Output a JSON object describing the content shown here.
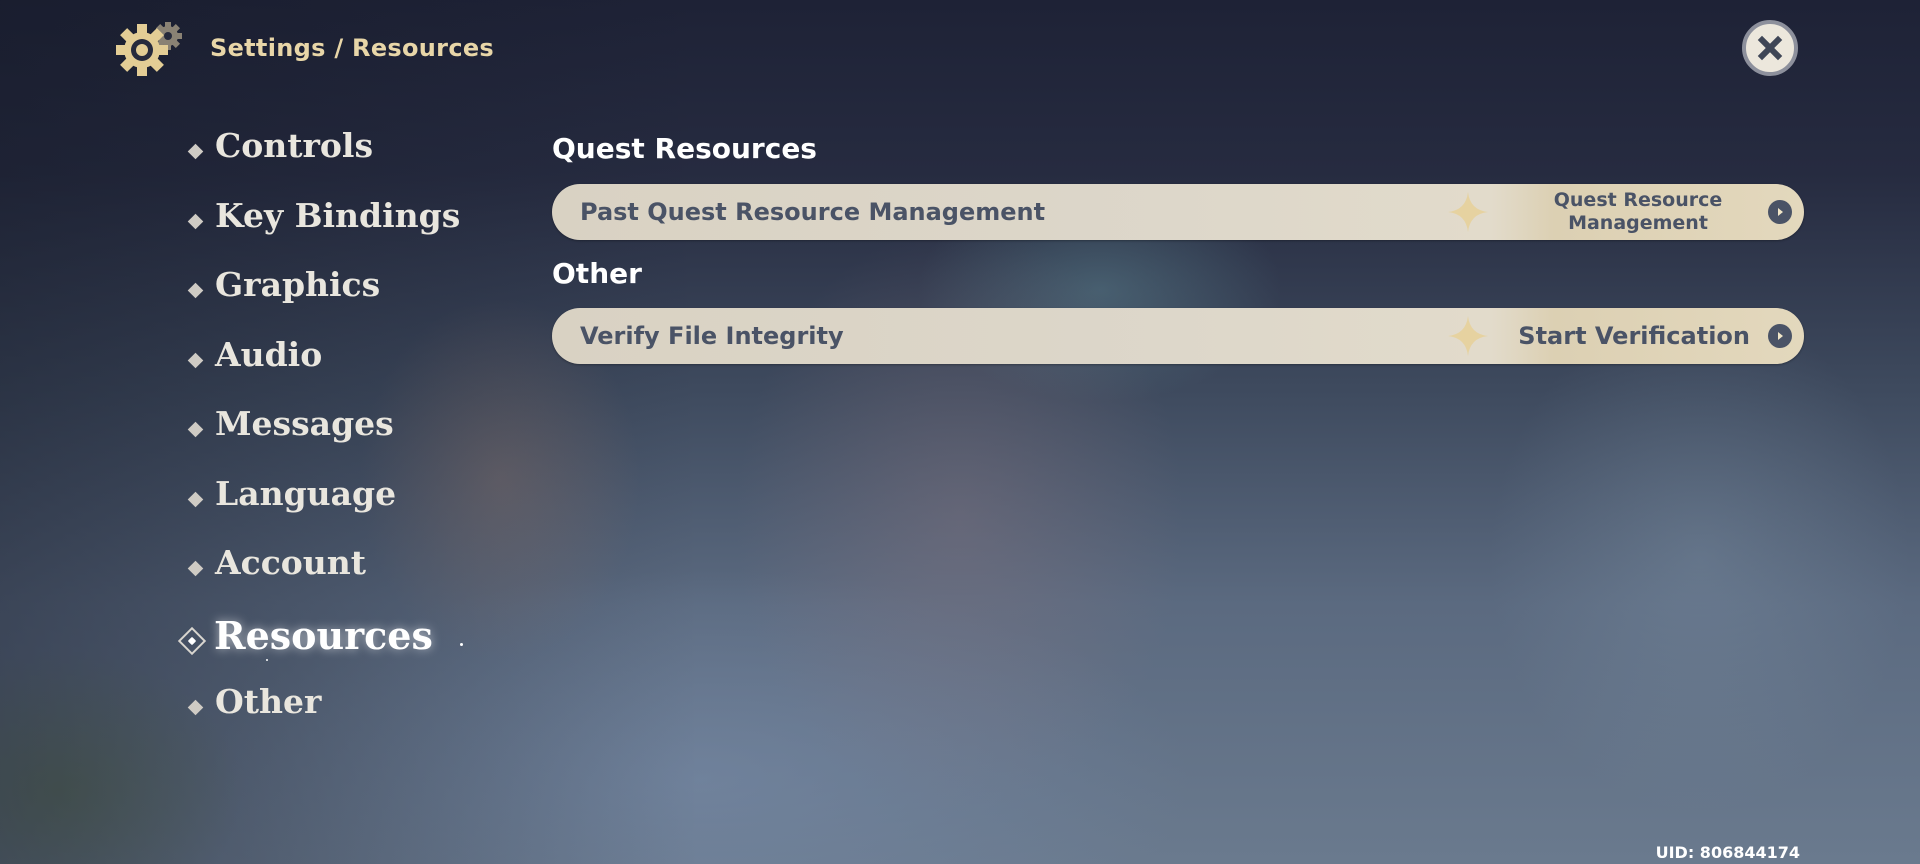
{
  "header": {
    "icon": "gear-icon",
    "breadcrumb": "Settings / Resources"
  },
  "close_button": {
    "icon": "close-icon",
    "label": "Close"
  },
  "sidebar": {
    "items": [
      {
        "label": "Controls",
        "active": false
      },
      {
        "label": "Key Bindings",
        "active": false
      },
      {
        "label": "Graphics",
        "active": false
      },
      {
        "label": "Audio",
        "active": false
      },
      {
        "label": "Messages",
        "active": false
      },
      {
        "label": "Language",
        "active": false
      },
      {
        "label": "Account",
        "active": false
      },
      {
        "label": "Resources",
        "active": true
      },
      {
        "label": "Other",
        "active": false
      }
    ]
  },
  "sections": [
    {
      "title": "Quest Resources",
      "rows": [
        {
          "label": "Past Quest Resource Management",
          "action": "Quest Resource Management",
          "action_lines": [
            "Quest Resource",
            "Management"
          ],
          "icon": "arrow-right-circle-icon"
        }
      ]
    },
    {
      "title": "Other",
      "rows": [
        {
          "label": "Verify File Integrity",
          "action": "Start Verification",
          "icon": "arrow-right-circle-icon"
        }
      ]
    }
  ],
  "footer": {
    "uid": "UID: 806844174"
  },
  "colors": {
    "accent_gold": "#e8d6a8",
    "row_text": "#4a5366",
    "row_bg": "#ddd7ca"
  }
}
